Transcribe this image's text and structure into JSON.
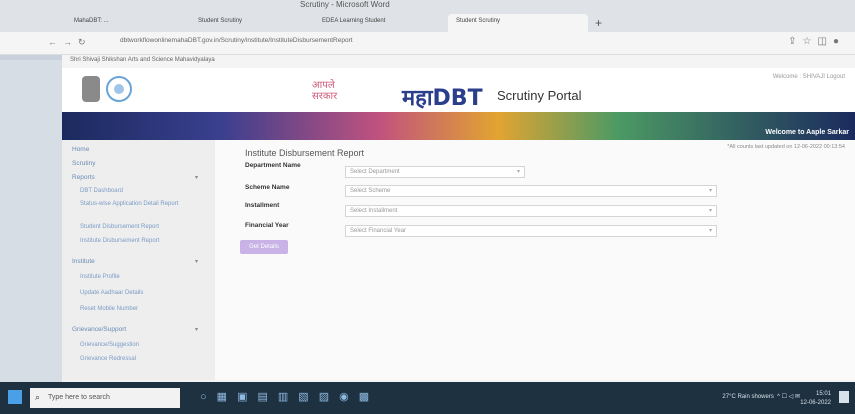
{
  "browser": {
    "window_title": "Scrutiny - Microsoft Word",
    "tabs": [
      {
        "label": "MahaDBT: ..."
      },
      {
        "label": "Student Scrutiny"
      },
      {
        "label": "EDEA Learning Student"
      },
      {
        "label": "Student Scrutiny"
      }
    ],
    "url": "dbtworkflowonlinemahaDBT.gov.in/Scrutiny/institute/InstituteDisbursementReport",
    "bookmark_text": "Shri Shivaji Shikshan Arts and Science Mahavidyalaya"
  },
  "header": {
    "logo_line1": "आपले",
    "logo_line2": "सरकार",
    "logo_maha": "महाDBT",
    "portal_title": "Scrutiny Portal",
    "user_text": "Welcome : SHIVAJI Logout"
  },
  "band": {
    "welcome": "Welcome to Aaple Sarkar"
  },
  "sidebar": {
    "items": [
      {
        "label": "Home"
      },
      {
        "label": "Scrutiny"
      },
      {
        "label": "Reports"
      },
      {
        "label": "DBT Dashboard"
      },
      {
        "label": "Status-wise Application Detail Report"
      },
      {
        "label": "Student Disbursement Report"
      },
      {
        "label": "Institute Disbursement Report"
      },
      {
        "label": "Institute"
      },
      {
        "label": "Institute Profile"
      },
      {
        "label": "Update Aadhaar Details"
      },
      {
        "label": "Reset Mobile Number"
      },
      {
        "label": "Grievance/Support"
      },
      {
        "label": "Grievance/Suggestion"
      },
      {
        "label": "Grievance Redressal"
      }
    ]
  },
  "main": {
    "title": "Institute Disbursement Report",
    "note": "*All counts last updated on 12-06-2022 00:13:54",
    "fields": [
      {
        "label": "Department Name",
        "placeholder": "Select Department"
      },
      {
        "label": "Scheme Name",
        "placeholder": "Select Scheme"
      },
      {
        "label": "Installment",
        "placeholder": "Select Installment"
      },
      {
        "label": "Financial Year",
        "placeholder": "Select Financial Year"
      }
    ],
    "get_button": "Get Details"
  },
  "taskbar": {
    "search_placeholder": "Type here to search",
    "weather": "27°C Rain showers",
    "time": "15:01",
    "date": "12-06-2022"
  }
}
